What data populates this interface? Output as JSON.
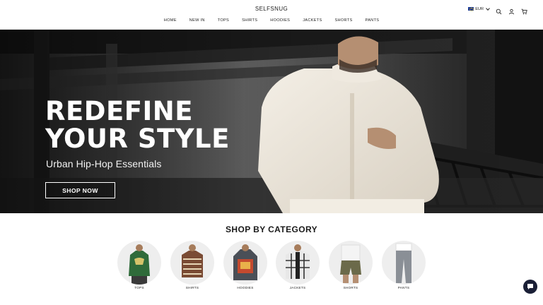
{
  "header": {
    "logo": "SELFSNUG",
    "nav": [
      "HOME",
      "NEW IN",
      "TOPS",
      "SHIRTS",
      "HOODIES",
      "JACKETS",
      "SHORTS",
      "PANTS"
    ],
    "currency": "EUR",
    "currency_flag": "eu-flag-icon",
    "icons": [
      "search-icon",
      "account-icon",
      "cart-icon"
    ]
  },
  "hero": {
    "title_line1": "REDEFINE",
    "title_line2": "YOUR STYLE",
    "subtitle": "Urban Hip-Hop Essentials",
    "button": "SHOP NOW"
  },
  "categories": {
    "title": "SHOP BY CATEGORY",
    "items": [
      "TOPS",
      "SHIRTS",
      "HOODIES",
      "JACKETS",
      "SHORTS",
      "PANTS"
    ]
  },
  "colors": {
    "accent": "#1a1f36",
    "hero_text": "#ffffff",
    "circle_bg": "#eeeeee"
  },
  "chat": {
    "icon": "chat-icon"
  }
}
